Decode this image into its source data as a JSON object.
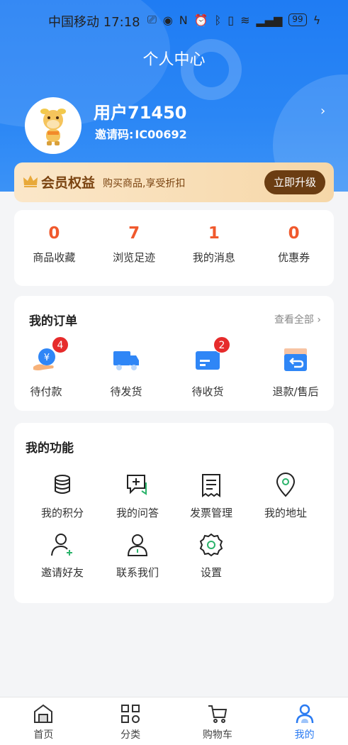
{
  "status": {
    "carrier_time": "中国移动 17:18",
    "battery": "99"
  },
  "page_title": "个人中心",
  "user": {
    "name": "用户71450",
    "invite_label": "邀请码:",
    "invite_code": "IC00692"
  },
  "member": {
    "title": "会员权益",
    "subtitle": "购买商品,享受折扣",
    "upgrade_label": "立即升级"
  },
  "stats": [
    {
      "value": "0",
      "label": "商品收藏"
    },
    {
      "value": "7",
      "label": "浏览足迹"
    },
    {
      "value": "1",
      "label": "我的消息"
    },
    {
      "value": "0",
      "label": "优惠券"
    }
  ],
  "orders": {
    "title": "我的订单",
    "see_all": "查看全部",
    "items": [
      {
        "label": "待付款",
        "badge": "4",
        "icon": "payment-icon"
      },
      {
        "label": "待发货",
        "badge": "",
        "icon": "truck-icon"
      },
      {
        "label": "待收货",
        "badge": "2",
        "icon": "package-icon"
      },
      {
        "label": "退款/售后",
        "badge": "",
        "icon": "refund-icon"
      }
    ]
  },
  "functions": {
    "title": "我的功能",
    "items": [
      {
        "label": "我的积分",
        "icon": "coins-icon"
      },
      {
        "label": "我的问答",
        "icon": "qa-icon"
      },
      {
        "label": "发票管理",
        "icon": "invoice-icon"
      },
      {
        "label": "我的地址",
        "icon": "location-icon"
      },
      {
        "label": "邀请好友",
        "icon": "add-user-icon"
      },
      {
        "label": "联系我们",
        "icon": "contact-icon"
      },
      {
        "label": "设置",
        "icon": "gear-icon"
      }
    ]
  },
  "nav": [
    {
      "label": "首页",
      "icon": "home-icon",
      "active": false
    },
    {
      "label": "分类",
      "icon": "category-icon",
      "active": false
    },
    {
      "label": "购物车",
      "icon": "cart-icon",
      "active": false
    },
    {
      "label": "我的",
      "icon": "profile-icon",
      "active": true
    }
  ],
  "colors": {
    "primary": "#2a7bf2",
    "accent": "#f0592d",
    "member_btn": "#6b3d12",
    "badge": "#e62b2b"
  }
}
